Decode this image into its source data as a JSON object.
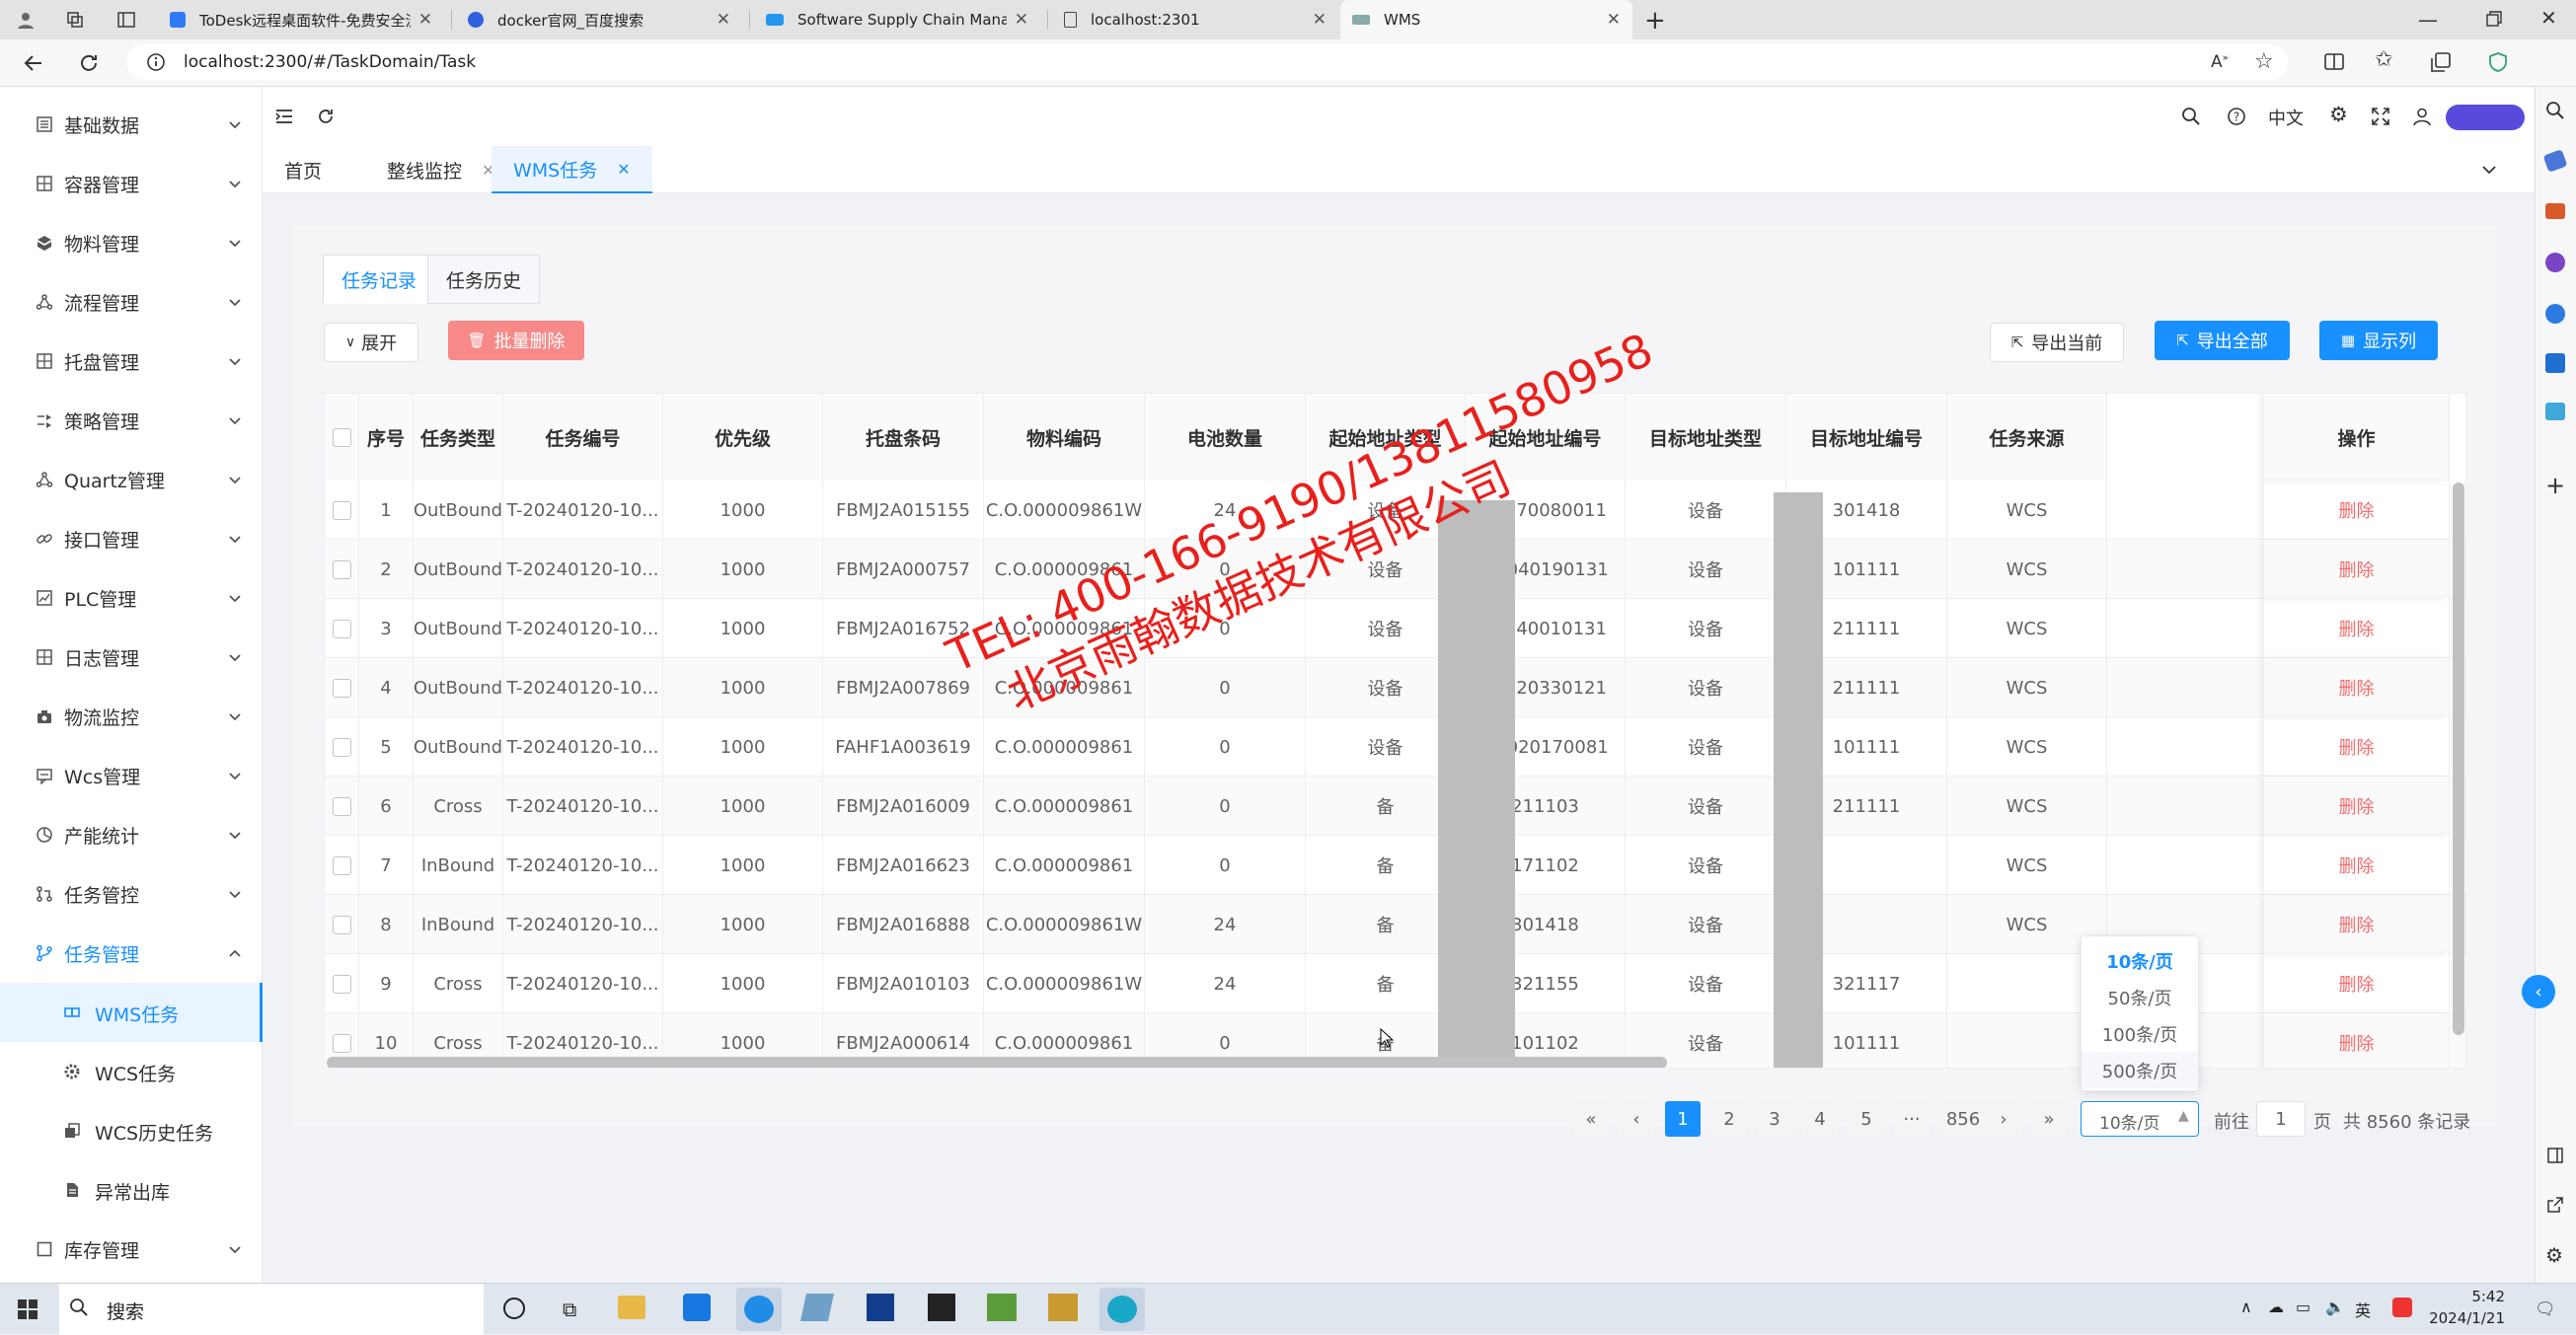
{
  "browser": {
    "tabs": [
      {
        "title": "ToDesk远程桌面软件-免费安全流"
      },
      {
        "title": "docker官网_百度搜索"
      },
      {
        "title": "Software Supply Chain Managem"
      },
      {
        "title": "localhost:2301"
      },
      {
        "title": "WMS"
      }
    ],
    "url": "localhost:2300/#/TaskDomain/Task"
  },
  "sidebar": {
    "items": [
      {
        "label": "基础数据",
        "icon": "list-icon"
      },
      {
        "label": "容器管理",
        "icon": "grid-icon"
      },
      {
        "label": "物料管理",
        "icon": "box-icon"
      },
      {
        "label": "流程管理",
        "icon": "flow-icon"
      },
      {
        "label": "托盘管理",
        "icon": "grid-icon"
      },
      {
        "label": "策略管理",
        "icon": "strategy-icon"
      },
      {
        "label": "Quartz管理",
        "icon": "flow-icon"
      },
      {
        "label": "接口管理",
        "icon": "link-icon"
      },
      {
        "label": "PLC管理",
        "icon": "chart-icon"
      },
      {
        "label": "日志管理",
        "icon": "grid-icon"
      },
      {
        "label": "物流监控",
        "icon": "camera-icon"
      },
      {
        "label": "Wcs管理",
        "icon": "message-icon"
      },
      {
        "label": "产能统计",
        "icon": "pie-icon"
      },
      {
        "label": "任务管控",
        "icon": "pull-request-icon"
      },
      {
        "label": "任务管理",
        "icon": "branch-icon"
      }
    ],
    "subitems": [
      {
        "label": "WMS任务"
      },
      {
        "label": "WCS任务"
      },
      {
        "label": "WCS历史任务"
      },
      {
        "label": "异常出库"
      }
    ],
    "last": {
      "label": "库存管理"
    }
  },
  "header": {
    "lang": "中文"
  },
  "pagetabs": [
    {
      "label": "首页"
    },
    {
      "label": "整线监控"
    },
    {
      "label": "WMS任务"
    }
  ],
  "inner_tabs": [
    {
      "label": "任务记录"
    },
    {
      "label": "任务历史"
    }
  ],
  "toolbar": {
    "expand": "展开",
    "batch_delete": "批量删除",
    "export_current": "导出当前",
    "export_all": "导出全部",
    "show_columns": "显示列"
  },
  "table": {
    "columns": [
      "序号",
      "任务类型",
      "任务编号",
      "优先级",
      "托盘条码",
      "物料编码",
      "电池数量",
      "起始地址类型",
      "起始地址编号",
      "目标地址类型",
      "目标地址编号",
      "任务来源",
      "操作"
    ],
    "action": "删除",
    "rows": [
      [
        "1",
        "OutBound",
        "T-20240120-10...",
        "1000",
        "FBMJ2A015155",
        "C.O.000009861W",
        "24",
        "设备",
        "F0170080011",
        "设备",
        "301418",
        "WCS"
      ],
      [
        "2",
        "OutBound",
        "T-20240120-10...",
        "1000",
        "FBMJ2A000757",
        "C.O.000009861",
        "0",
        "设备",
        "G0040190131",
        "设备",
        "101111",
        "WCS"
      ],
      [
        "3",
        "OutBound",
        "T-20240120-10...",
        "1000",
        "FBMJ2A016752",
        "C.O.000009861",
        "0",
        "设备",
        "F0140010131",
        "设备",
        "211111",
        "WCS"
      ],
      [
        "4",
        "OutBound",
        "T-20240120-10...",
        "1000",
        "FBMJ2A007869",
        "C.O.000009861",
        "0",
        "设备",
        "F0120330121",
        "设备",
        "211111",
        "WCS"
      ],
      [
        "5",
        "OutBound",
        "T-20240120-10...",
        "1000",
        "FAHF1A003619",
        "C.O.000009861",
        "0",
        "设备",
        "G0020170081",
        "设备",
        "101111",
        "WCS"
      ],
      [
        "6",
        "Cross",
        "T-20240120-10...",
        "1000",
        "FBMJ2A016009",
        "C.O.000009861",
        "0",
        "备",
        "211103",
        "设备",
        "211111",
        "WCS"
      ],
      [
        "7",
        "InBound",
        "T-20240120-10...",
        "1000",
        "FBMJ2A016623",
        "C.O.000009861",
        "0",
        "备",
        "171102",
        "设备",
        "",
        "WCS"
      ],
      [
        "8",
        "InBound",
        "T-20240120-10...",
        "1000",
        "FBMJ2A016888",
        "C.O.000009861W",
        "24",
        "备",
        "301418",
        "设备",
        "",
        "WCS"
      ],
      [
        "9",
        "Cross",
        "T-20240120-10...",
        "1000",
        "FBMJ2A010103",
        "C.O.000009861W",
        "24",
        "备",
        "321155",
        "设备",
        "321117",
        ""
      ],
      [
        "10",
        "Cross",
        "T-20240120-10...",
        "1000",
        "FBMJ2A000614",
        "C.O.000009861",
        "0",
        "备",
        "101102",
        "设备",
        "101111",
        ""
      ]
    ]
  },
  "watermark": {
    "line1": "TEL: 400-166-9190/13811580958",
    "line2": "北京雨翰数据技术有限公司"
  },
  "pagination": {
    "pages": [
      "1",
      "2",
      "3",
      "4",
      "5"
    ],
    "ellipsis": "···",
    "last": "856",
    "page_size": "10条/页",
    "size_options": [
      "10条/页",
      "50条/页",
      "100条/页",
      "500条/页"
    ],
    "goto_label": "前往",
    "goto_value": "1",
    "page_unit": "页",
    "total": "共 8560 条记录"
  },
  "taskbar": {
    "search": "搜索",
    "ime": "英",
    "time": "5:42",
    "date": "2024/1/21"
  },
  "colors": {
    "primary": "#1890ff",
    "danger": "#f56c6c",
    "danger_btn": "#f78989"
  }
}
